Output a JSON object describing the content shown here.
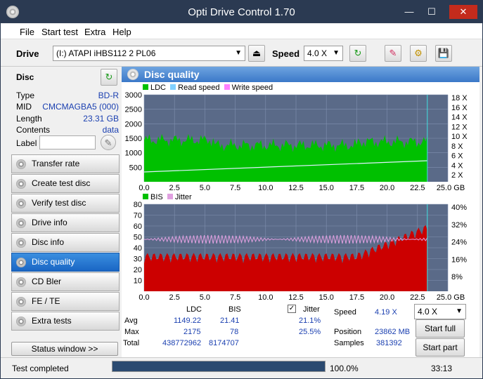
{
  "window": {
    "title": "Opti Drive Control 1.70"
  },
  "menu": [
    "File",
    "Start test",
    "Extra",
    "Help"
  ],
  "toolbar": {
    "drive_label": "Drive",
    "drive_value": "(I:)  ATAPI iHBS112  2 PL06",
    "speed_label": "Speed",
    "speed_value": "4.0 X"
  },
  "disc": {
    "header": "Disc",
    "rows": [
      {
        "k": "Type",
        "v": "BD-R"
      },
      {
        "k": "MID",
        "v": "CMCMAGBA5 (000)"
      },
      {
        "k": "Length",
        "v": "23.31 GB"
      },
      {
        "k": "Contents",
        "v": "data"
      }
    ],
    "label_key": "Label"
  },
  "nav": [
    "Transfer rate",
    "Create test disc",
    "Verify test disc",
    "Drive info",
    "Disc info",
    "Disc quality",
    "CD Bler",
    "FE / TE",
    "Extra tests"
  ],
  "nav_active": "Disc quality",
  "status_window_btn": "Status window >>",
  "panel_title": "Disc quality",
  "chart1_legend": [
    "LDC",
    "Read speed",
    "Write speed"
  ],
  "chart2_legend": [
    "BIS",
    "Jitter"
  ],
  "chart1_yticks": [
    "3000",
    "2500",
    "2000",
    "1500",
    "1000",
    "500"
  ],
  "chart1_rticks": [
    "18 X",
    "16 X",
    "14 X",
    "12 X",
    "10 X",
    "8 X",
    "6 X",
    "4 X",
    "2 X"
  ],
  "chart2_yticks": [
    "80",
    "70",
    "60",
    "50",
    "40",
    "30",
    "20",
    "10"
  ],
  "chart2_rticks": [
    "40%",
    "32%",
    "24%",
    "16%",
    "8%"
  ],
  "xticks": [
    "0.0",
    "2.5",
    "5.0",
    "7.5",
    "10.0",
    "12.5",
    "15.0",
    "17.5",
    "20.0",
    "22.5",
    "25.0 GB"
  ],
  "stats": {
    "col_ldc": "LDC",
    "col_bis": "BIS",
    "col_jitter": "Jitter",
    "rows": [
      {
        "label": "Avg",
        "ldc": "1149.22",
        "bis": "21.41",
        "jitter": "21.1%"
      },
      {
        "label": "Max",
        "ldc": "2175",
        "bis": "78",
        "jitter": "25.5%"
      },
      {
        "label": "Total",
        "ldc": "438772962",
        "bis": "8174707",
        "jitter": ""
      }
    ],
    "speed_label": "Speed",
    "speed_value": "4.19 X",
    "speed_select": "4.0 X",
    "position_label": "Position",
    "position_value": "23862 MB",
    "samples_label": "Samples",
    "samples_value": "381392",
    "start_full": "Start full",
    "start_part": "Start part"
  },
  "status": {
    "text": "Test completed",
    "progress": "100.0%",
    "time": "33:13",
    "progress_fraction": 1.0
  },
  "colors": {
    "ldc": "#00c000",
    "read": "#80d0ff",
    "write": "#ff80ff",
    "bis": "#cc0000",
    "jitter": "#e0a0e0",
    "plotbg": "#5a6a88"
  }
}
